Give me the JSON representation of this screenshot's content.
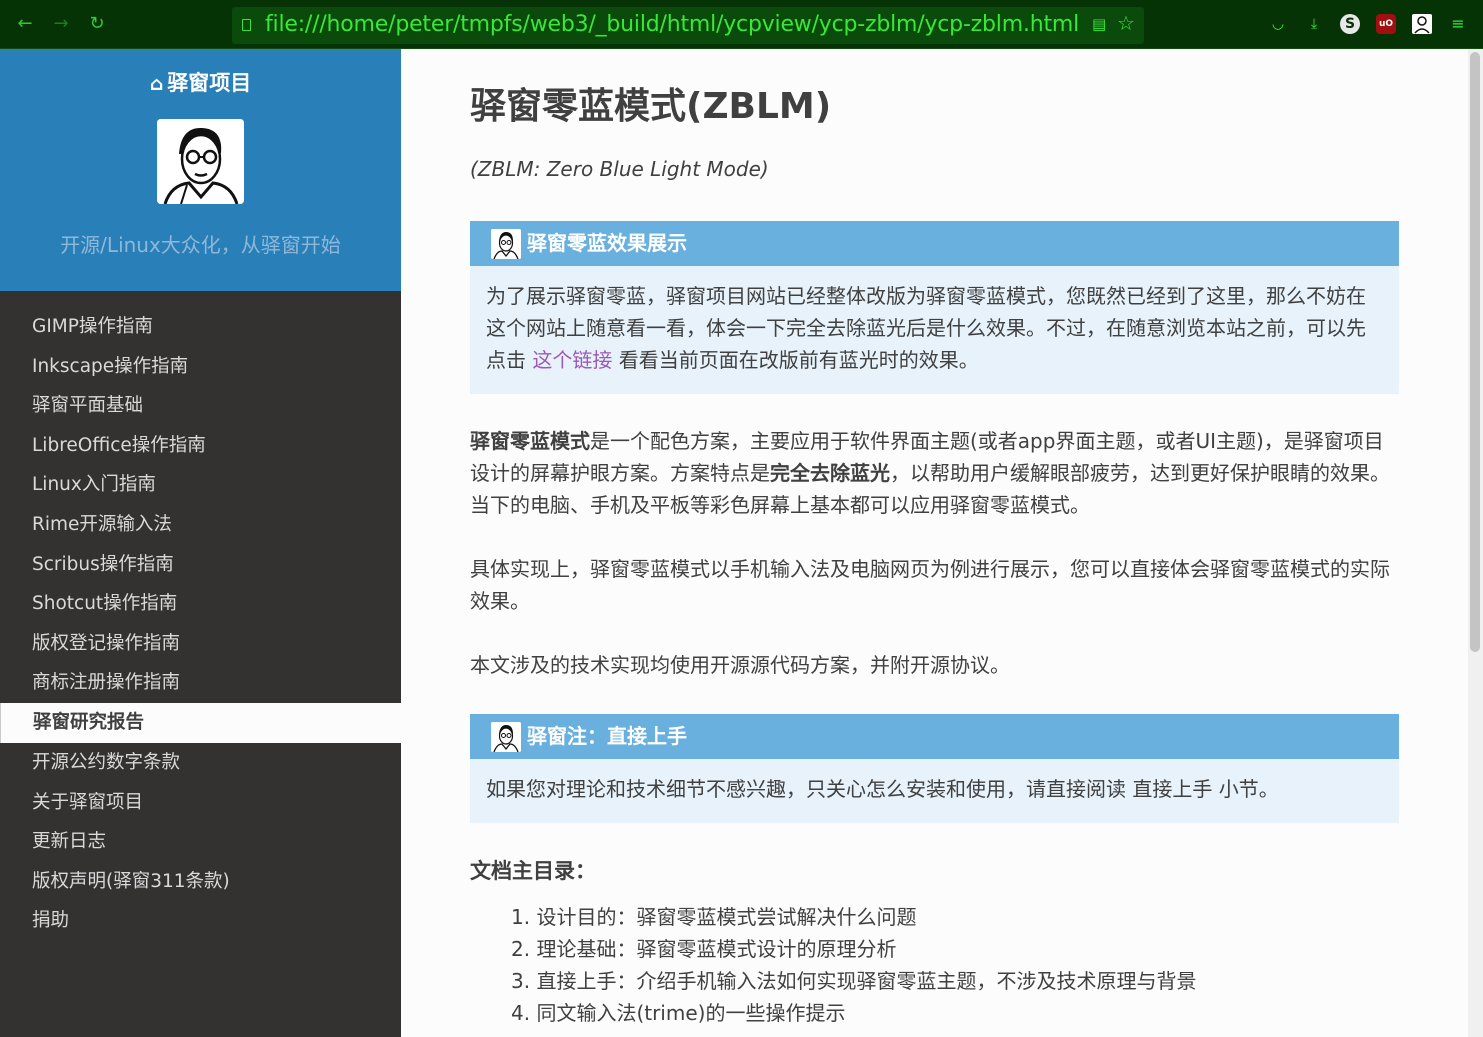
{
  "browser": {
    "url": "file:///home/peter/tmpfs/web3/_build/html/ycpview/ycp-zblm/ycp-zblm.html",
    "accent_color": "#38e838",
    "toolbar_bg": "#063306"
  },
  "sidebar": {
    "home_label": "驿窗项目",
    "tagline": "开源/Linux大众化，从驿窗开始",
    "items": [
      {
        "label": "GIMP操作指南"
      },
      {
        "label": "Inkscape操作指南"
      },
      {
        "label": "驿窗平面基础"
      },
      {
        "label": "LibreOffice操作指南"
      },
      {
        "label": "Linux入门指南"
      },
      {
        "label": "Rime开源输入法"
      },
      {
        "label": "Scribus操作指南"
      },
      {
        "label": "Shotcut操作指南"
      },
      {
        "label": "版权登记操作指南"
      },
      {
        "label": "商标注册操作指南"
      },
      {
        "label": "驿窗研究报告",
        "current": true
      },
      {
        "label": "开源公约数字条款"
      },
      {
        "label": "关于驿窗项目"
      },
      {
        "label": "更新日志"
      },
      {
        "label": "版权声明(驿窗311条款)"
      },
      {
        "label": "捐助"
      }
    ]
  },
  "main": {
    "title": "驿窗零蓝模式(ZBLM)",
    "subtitle": "(ZBLM: Zero Blue Light Mode)",
    "admonition1": {
      "title": "驿窗零蓝效果展示",
      "text_before": "为了展示驿窗零蓝，驿窗项目网站已经整体改版为驿窗零蓝模式，您既然已经到了这里，那么不妨在这个网站上随意看一看，体会一下完全去除蓝光后是什么效果。不过，在随意浏览本站之前，可以先点击 ",
      "link": "这个链接",
      "text_after": " 看看当前页面在改版前有蓝光时的效果。"
    },
    "para1": {
      "bold1": "驿窗零蓝模式",
      "text1": "是一个配色方案，主要应用于软件界面主题(或者app界面主题，或者UI主题)，是驿窗项目设计的屏幕护眼方案。方案特点是",
      "bold2": "完全去除蓝光",
      "text2": "，以帮助用户缓解眼部疲劳，达到更好保护眼睛的效果。当下的电脑、手机及平板等彩色屏幕上基本都可以应用驿窗零蓝模式。"
    },
    "para2": "具体实现上，驿窗零蓝模式以手机输入法及电脑网页为例进行展示，您可以直接体会驿窗零蓝模式的实际效果。",
    "para3": "本文涉及的技术实现均使用开源源代码方案，并附开源协议。",
    "admonition2": {
      "title": "驿窗注：直接上手",
      "text": "如果您对理论和技术细节不感兴趣，只关心怎么安装和使用，请直接阅读 直接上手 小节。"
    },
    "toc_title": "文档主目录：",
    "toc": [
      "1. 设计目的：驿窗零蓝模式尝试解决什么问题",
      "2. 理论基础：驿窗零蓝模式设计的原理分析",
      "3. 直接上手：介绍手机输入法如何实现驿窗零蓝主题，不涉及技术原理与背景",
      "4. 同文输入法(trime)的一些操作提示"
    ]
  }
}
